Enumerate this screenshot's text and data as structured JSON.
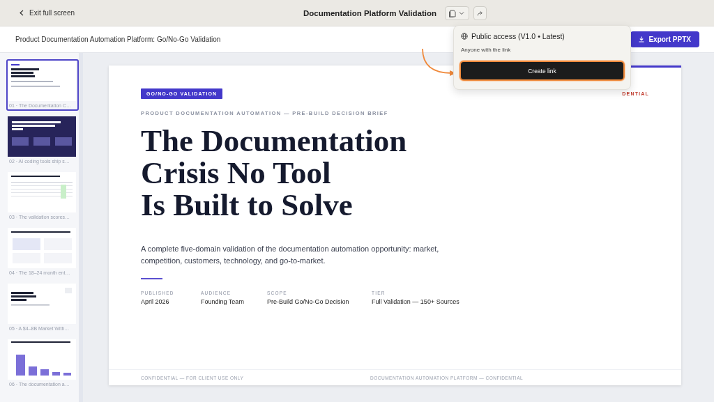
{
  "top_bar": {
    "back_label": "Exit full screen",
    "title": "Documentation Platform Validation"
  },
  "header": {
    "title": "Product Documentation Automation Platform: Go/No-Go Validation",
    "export_button": "Export PPTX"
  },
  "share_popover": {
    "title": "Public access (V1.0 • Latest)",
    "subtitle": "Anyone with the link",
    "button": "Create link"
  },
  "slides_panel": [
    {
      "label": "01 · The Documentation C…",
      "selected": true,
      "kind": "title"
    },
    {
      "label": "02 · AI coding tools ship s…",
      "selected": false,
      "kind": "dark"
    },
    {
      "label": "03 · The validation scores…",
      "selected": false,
      "kind": "table"
    },
    {
      "label": "04 · The 18–24 month ent…",
      "selected": false,
      "kind": "cards"
    },
    {
      "label": "05 · A $4–8B Market With…",
      "selected": false,
      "kind": "market"
    },
    {
      "label": "06 · The documentation a…",
      "selected": false,
      "kind": "chart"
    }
  ],
  "slide": {
    "badge": "GO/NO-GO VALIDATION",
    "corner_label": "DENTIAL",
    "eyebrow": "PRODUCT DOCUMENTATION AUTOMATION — PRE-BUILD DECISION BRIEF",
    "heading": [
      "The Documentation",
      "Crisis No Tool",
      "Is Built to Solve"
    ],
    "summary": "A complete five-domain validation of the documentation automation opportunity: market, competition, customers, technology, and go-to-market.",
    "meta": [
      {
        "label": "PUBLISHED",
        "value": "April 2026"
      },
      {
        "label": "AUDIENCE",
        "value": "Founding Team"
      },
      {
        "label": "SCOPE",
        "value": "Pre-Build Go/No-Go Decision"
      },
      {
        "label": "TIER",
        "value": "Full Validation — 150+ Sources"
      }
    ],
    "footer": [
      "CONFIDENTIAL — FOR CLIENT USE ONLY",
      "DOCUMENTATION AUTOMATION PLATFORM — CONFIDENTIAL"
    ]
  }
}
